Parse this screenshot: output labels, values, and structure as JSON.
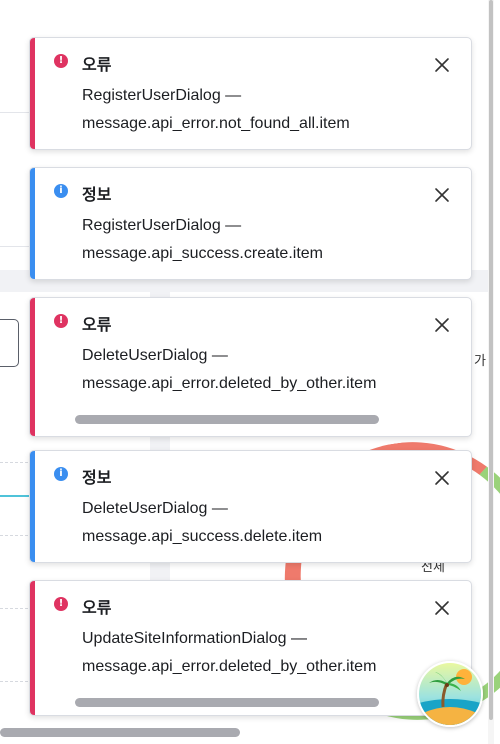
{
  "background": {
    "right_label_1": "가",
    "right_label_2": "전체"
  },
  "toasts": [
    {
      "type": "error",
      "title": "오류",
      "source": "RegisterUserDialog —",
      "message": "message.api_error.not_found_all.item"
    },
    {
      "type": "info",
      "title": "정보",
      "source": "RegisterUserDialog —",
      "message": "message.api_success.create.item"
    },
    {
      "type": "error",
      "title": "오류",
      "source": "DeleteUserDialog —",
      "message": "message.api_error.deleted_by_other.item"
    },
    {
      "type": "info",
      "title": "정보",
      "source": "DeleteUserDialog —",
      "message": "message.api_success.delete.item"
    },
    {
      "type": "error",
      "title": "오류",
      "source": "UpdateSiteInformationDialog —",
      "message": "message.api_error.deleted_by_other.item"
    }
  ],
  "icons": {
    "error": "exclamation-circle-icon",
    "info": "info-circle-icon",
    "close": "close-icon",
    "avatar": "beach-palm-avatar"
  },
  "colors": {
    "error": "#df3361",
    "info": "#3a8ef0"
  }
}
